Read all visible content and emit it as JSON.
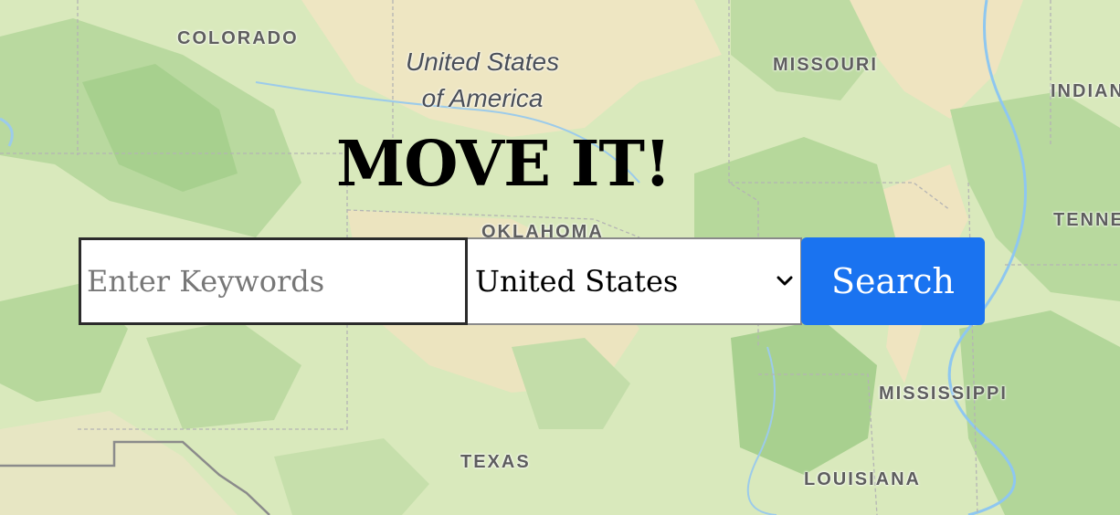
{
  "page": {
    "title": "MOVE IT!"
  },
  "search": {
    "keywords_placeholder": "Enter Keywords",
    "keywords_value": "",
    "country_selected": "United States",
    "button_label": "Search",
    "button_color": "#1a73f0"
  },
  "map": {
    "country_label_line1": "United States",
    "country_label_line2": "of America",
    "state_labels": {
      "colorado": "COLORADO",
      "missouri": "MISSOURI",
      "indiana": "INDIAN",
      "oklahoma": "OKLAHOMA",
      "tennessee": "TENNE",
      "mississippi": "MISSISSIPPI",
      "texas": "TEXAS",
      "louisiana": "LOUISIANA"
    },
    "colors": {
      "land": "#d8e8bb",
      "forest": "#b5d79b",
      "forest_dark": "#9fcd8a",
      "dry": "#f1e6c1",
      "border": "#b9b9b9",
      "river": "#8ec7f0"
    }
  }
}
